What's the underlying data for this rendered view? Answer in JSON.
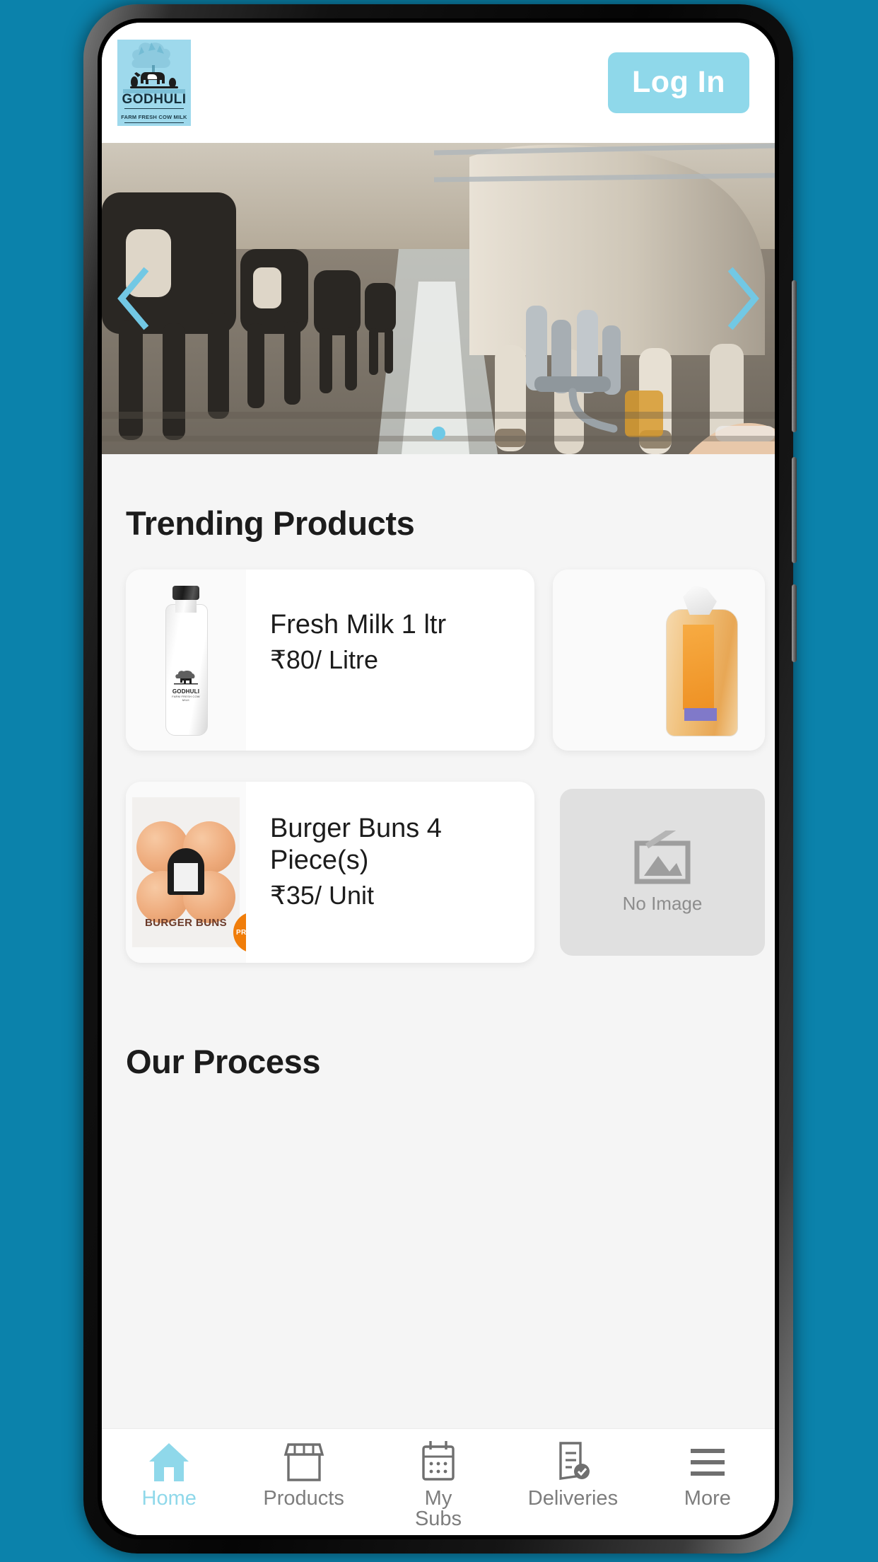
{
  "theme": {
    "page_background": "#0b82ab",
    "accent_blue": "#8fd8ea",
    "premium_orange": "#f07d0a",
    "surface": "#f5f5f5",
    "card": "#ffffff"
  },
  "header": {
    "logo": {
      "icon": "godhuli-cow-logo",
      "wordmark": "GODHULI",
      "tagline": "FARM FRESH COW MILK",
      "background_color": "#9ed9ec"
    },
    "login_label": "Log In"
  },
  "carousel": {
    "image_alt": "dairy-farm-milking-parlour-cows",
    "prev_icon": "chevron-left-icon",
    "next_icon": "chevron-right-icon",
    "dots": 1,
    "active_dot": 0
  },
  "sections": {
    "trending_title": "Trending Products",
    "process_title": "Our Process"
  },
  "products": [
    {
      "name": "Fresh Milk 1 ltr",
      "price": "₹80/ Litre",
      "image": "milk-bottle",
      "premium": false
    },
    {
      "name": "Burger Buns 4 Piece(s)",
      "price": "₹35/ Unit",
      "image": "burger-buns-pack",
      "premium": true,
      "badge_label": "PREMIUM"
    }
  ],
  "secondary_products": [
    {
      "image": "bread-loaf",
      "placeholder": false
    },
    {
      "image": "no-image-placeholder",
      "placeholder": true,
      "placeholder_label": "No Image"
    }
  ],
  "bottom_nav": {
    "items": [
      {
        "label": "Home",
        "icon": "home-icon",
        "active": true
      },
      {
        "label": "Products",
        "icon": "storefront-icon",
        "active": false
      },
      {
        "label": "My\nSubs",
        "icon": "calendar-icon",
        "active": false
      },
      {
        "label": "Deliveries",
        "icon": "document-check-icon",
        "active": false
      },
      {
        "label": "More",
        "icon": "hamburger-menu-icon",
        "active": false
      }
    ]
  }
}
